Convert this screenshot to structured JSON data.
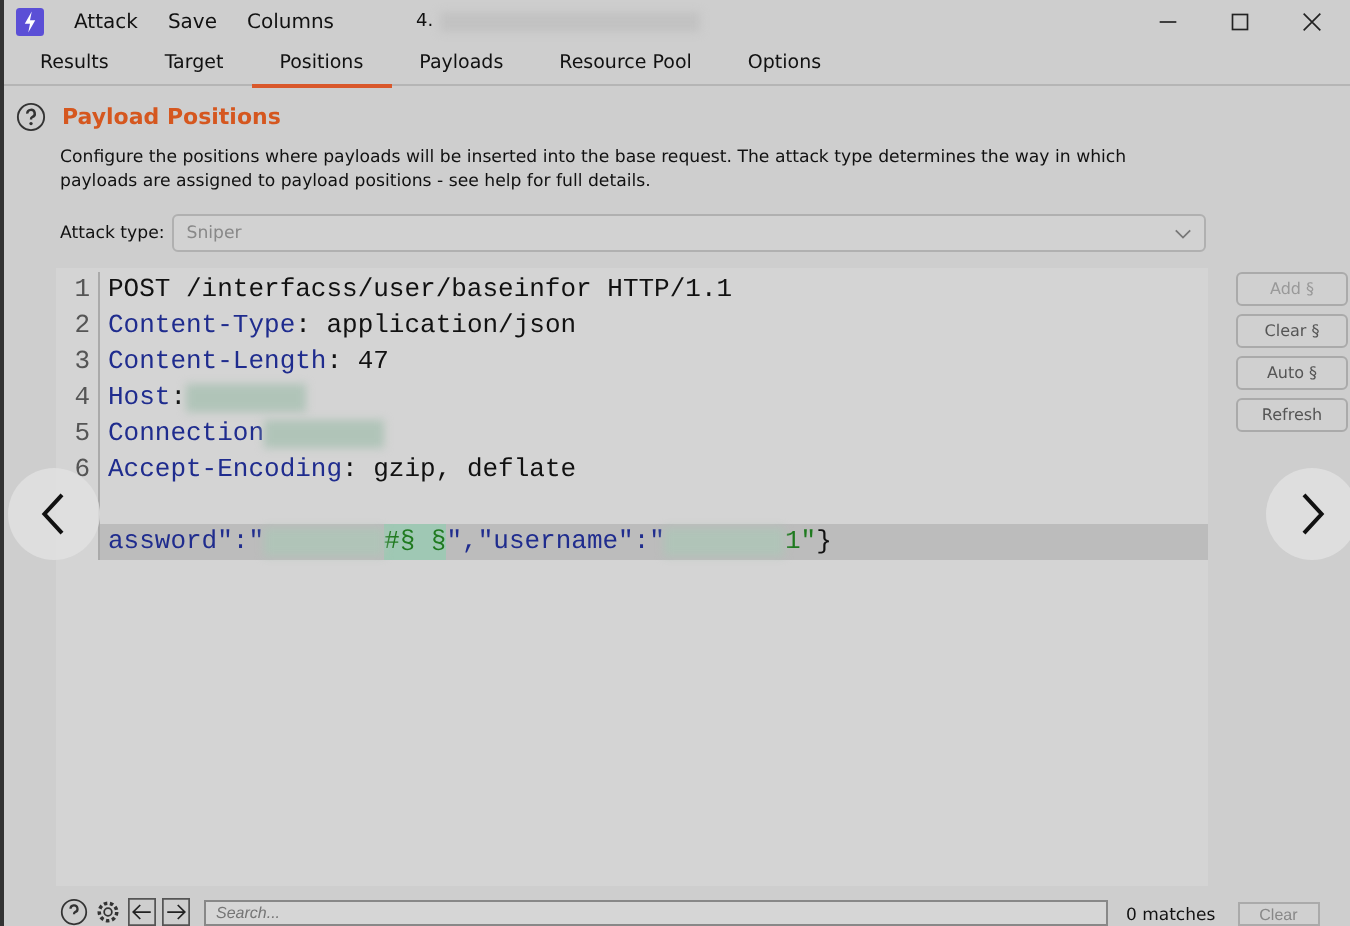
{
  "window": {
    "title": "4."
  },
  "menu": [
    "Attack",
    "Save",
    "Columns"
  ],
  "tabs": [
    {
      "label": "Results",
      "selected": false
    },
    {
      "label": "Target",
      "selected": false
    },
    {
      "label": "Positions",
      "selected": true
    },
    {
      "label": "Payloads",
      "selected": false
    },
    {
      "label": "Resource Pool",
      "selected": false
    },
    {
      "label": "Options",
      "selected": false
    }
  ],
  "section": {
    "title": "Payload Positions",
    "description": "Configure the positions where payloads will be inserted into the base request. The attack type determines the way in which payloads are assigned to payload positions - see help for full details."
  },
  "attack_type": {
    "label": "Attack type:",
    "value": "Sniper",
    "disabled": true
  },
  "editor": {
    "lines": [
      {
        "number": "1",
        "highlighted": false,
        "parts": [
          {
            "kind": "text",
            "text": "POST /interfacss/user/baseinfor HTTP/1.1"
          }
        ]
      },
      {
        "number": "2",
        "highlighted": false,
        "parts": [
          {
            "kind": "key",
            "text": "Content-Type"
          },
          {
            "kind": "text",
            "text": ": application/json"
          }
        ]
      },
      {
        "number": "3",
        "highlighted": false,
        "parts": [
          {
            "kind": "key",
            "text": "Content-Length"
          },
          {
            "kind": "text",
            "text": ": 47"
          }
        ]
      },
      {
        "number": "4",
        "highlighted": false,
        "parts": [
          {
            "kind": "key",
            "text": "Host"
          },
          {
            "kind": "text",
            "text": ":"
          },
          {
            "kind": "redacted"
          }
        ]
      },
      {
        "number": "5",
        "highlighted": false,
        "parts": [
          {
            "kind": "key",
            "text": "Connection"
          },
          {
            "kind": "redacted"
          }
        ]
      },
      {
        "number": "6",
        "highlighted": false,
        "parts": [
          {
            "kind": "key",
            "text": "Accept-Encoding"
          },
          {
            "kind": "text",
            "text": ": gzip, deflate"
          }
        ]
      },
      {
        "highlighted": false
      },
      {
        "highlighted": true,
        "parts": [
          {
            "kind": "key",
            "text": "assword\":\""
          },
          {
            "kind": "redacted"
          },
          {
            "kind": "marker",
            "text": "#§ §"
          },
          {
            "kind": "key",
            "text": "\",\"username\":\""
          },
          {
            "kind": "redacted"
          },
          {
            "kind": "string",
            "text": "1\""
          },
          {
            "kind": "text",
            "text": "}"
          }
        ]
      }
    ]
  },
  "side_buttons": [
    {
      "label": "Add §",
      "disabled": true
    },
    {
      "label": "Clear §",
      "disabled": false
    },
    {
      "label": "Auto §",
      "disabled": false
    },
    {
      "label": "Refresh",
      "disabled": false
    }
  ],
  "search": {
    "placeholder": "Search...",
    "matches": "0 matches",
    "clear": "Clear"
  }
}
